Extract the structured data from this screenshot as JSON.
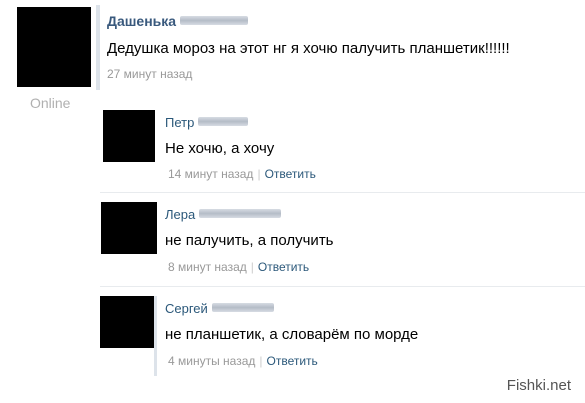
{
  "post": {
    "author": "Дашенька",
    "text": "Дедушка мороз на этот нг я хочю палучить планшетик!!!!!!",
    "time": "27 минут назад",
    "status": "Online"
  },
  "comments": [
    {
      "author": "Петр",
      "text": "Не хочю, а хочу",
      "time": "14 минут назад",
      "reply_label": "Ответить"
    },
    {
      "author": "Лера",
      "text": "не палучить, а получить",
      "time": "8 минут назад",
      "reply_label": "Ответить"
    },
    {
      "author": "Сергей",
      "text": "не планшетик, а словарём по морде",
      "time": "4 минуты назад",
      "reply_label": "Ответить"
    }
  ],
  "watermark": "Fishki.net"
}
